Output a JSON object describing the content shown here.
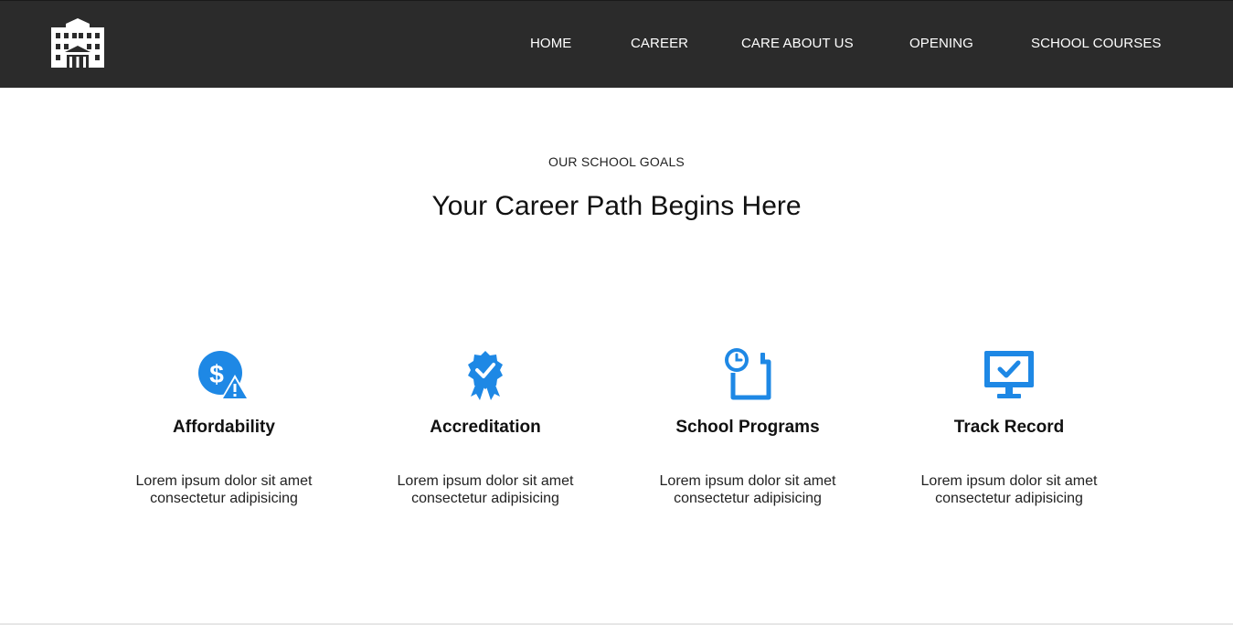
{
  "nav": {
    "logo_icon": "school-building-icon",
    "items": [
      {
        "label": "HOME"
      },
      {
        "label": "CAREER"
      },
      {
        "label": "CARE ABOUT US"
      },
      {
        "label": "OPENING"
      },
      {
        "label": "SCHOOL COURSES"
      }
    ]
  },
  "hero": {
    "subtitle": "OUR SCHOOL GOALS",
    "title": "Your Career Path Begins Here"
  },
  "features": [
    {
      "icon": "dollar-warning-icon",
      "title": "Affordability",
      "text": "Lorem ipsum dolor sit amet consectetur adipisicing"
    },
    {
      "icon": "award-badge-icon",
      "title": "Accreditation",
      "text": "Lorem ipsum dolor sit amet consectetur adipisicing"
    },
    {
      "icon": "calendar-clock-icon",
      "title": "School Programs",
      "text": "Lorem ipsum dolor sit amet consectetur adipisicing"
    },
    {
      "icon": "monitor-check-icon",
      "title": "Track Record",
      "text": "Lorem ipsum dolor sit amet consectetur adipisicing"
    }
  ],
  "colors": {
    "nav_background": "#2b2b2b",
    "accent": "#1e88e5",
    "text": "#111111"
  }
}
